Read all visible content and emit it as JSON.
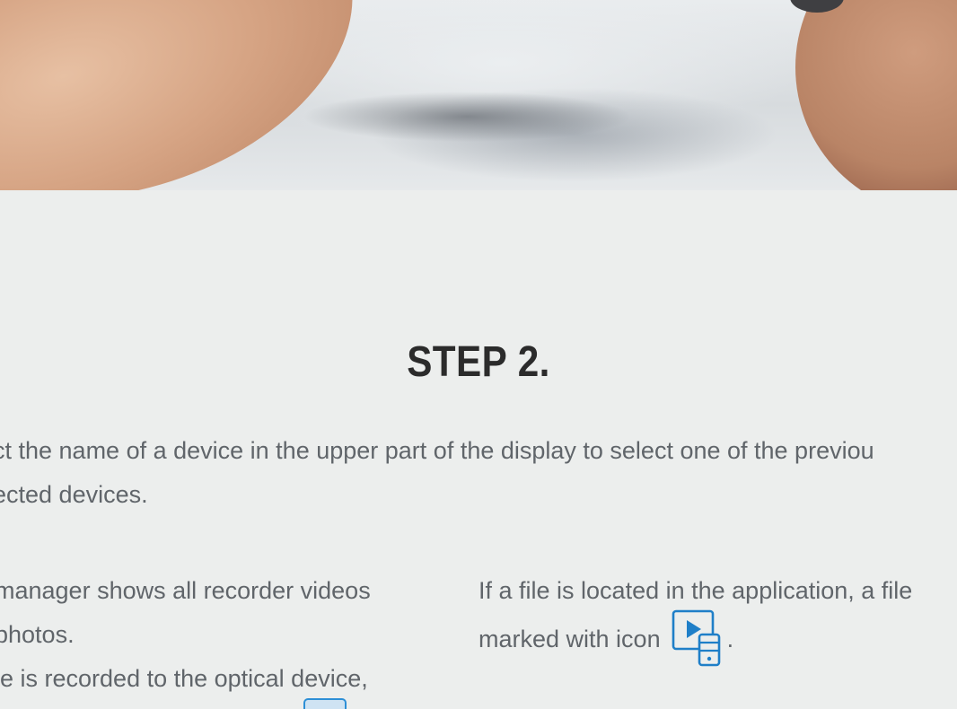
{
  "hero": {
    "alt": ""
  },
  "step": {
    "title": "STEP 2."
  },
  "intro": {
    "line1": "ct the name of a device in the upper part of the display to select one of the previou",
    "line2": "ected devices."
  },
  "left_column": {
    "line1": "manager shows all recorder videos",
    "line2": "photos.",
    "line3": "le is recorded to the optical device,"
  },
  "right_column": {
    "line1": "If a file is located in the application, a file",
    "line2_before_icon": "marked with icon",
    "line2_after_icon": "."
  },
  "colors": {
    "background": "#eceeed",
    "title": "#2b2b2b",
    "body_text": "#60656a",
    "icon_blue": "#1f7fc8"
  },
  "icons": {
    "file_icon": "play-on-phone-icon"
  }
}
